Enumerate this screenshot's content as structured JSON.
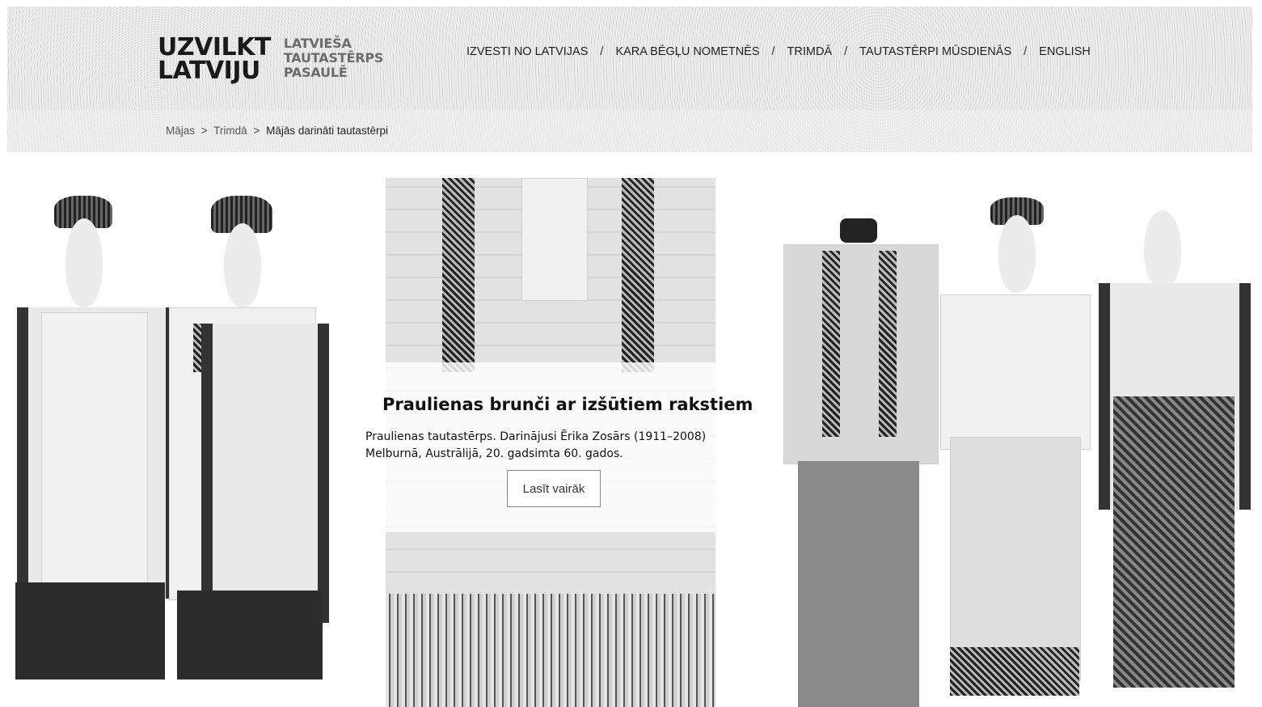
{
  "logo": {
    "main_line1": "UZVILKT",
    "main_line2": "LATVIJU",
    "sub_line1": "LATVIEŠA",
    "sub_line2": "TAUTASTĒRPS",
    "sub_line3": "PASAULĒ"
  },
  "nav": {
    "items": [
      {
        "label": "IZVESTI NO LATVIJAS"
      },
      {
        "label": "KARA BĒGĻU NOMETNĒS"
      },
      {
        "label": "TRIMDĀ"
      },
      {
        "label": "TAUTASTĒRPI MŪSDIENĀS"
      },
      {
        "label": "ENGLISH"
      }
    ],
    "separator": "/"
  },
  "breadcrumb": {
    "home": "Mājas",
    "section": "Trimdā",
    "current": "Mājās darināti tautastērpi",
    "separator": ">"
  },
  "slide": {
    "title": "Praulienas brunči ar izšūtiem rakstiem",
    "description_line1": "Praulienas tautastērps. Darinājusi Ērika Zosārs (1911–2008)",
    "description_line2": "Melburnā, Austrālijā, 20. gadsimta 60. gados.",
    "button_label": "Lasīt vairāk"
  },
  "colors": {
    "header_bg": "#e6e6e6",
    "text": "#111111",
    "logo_sub": "#6b6b6b"
  }
}
